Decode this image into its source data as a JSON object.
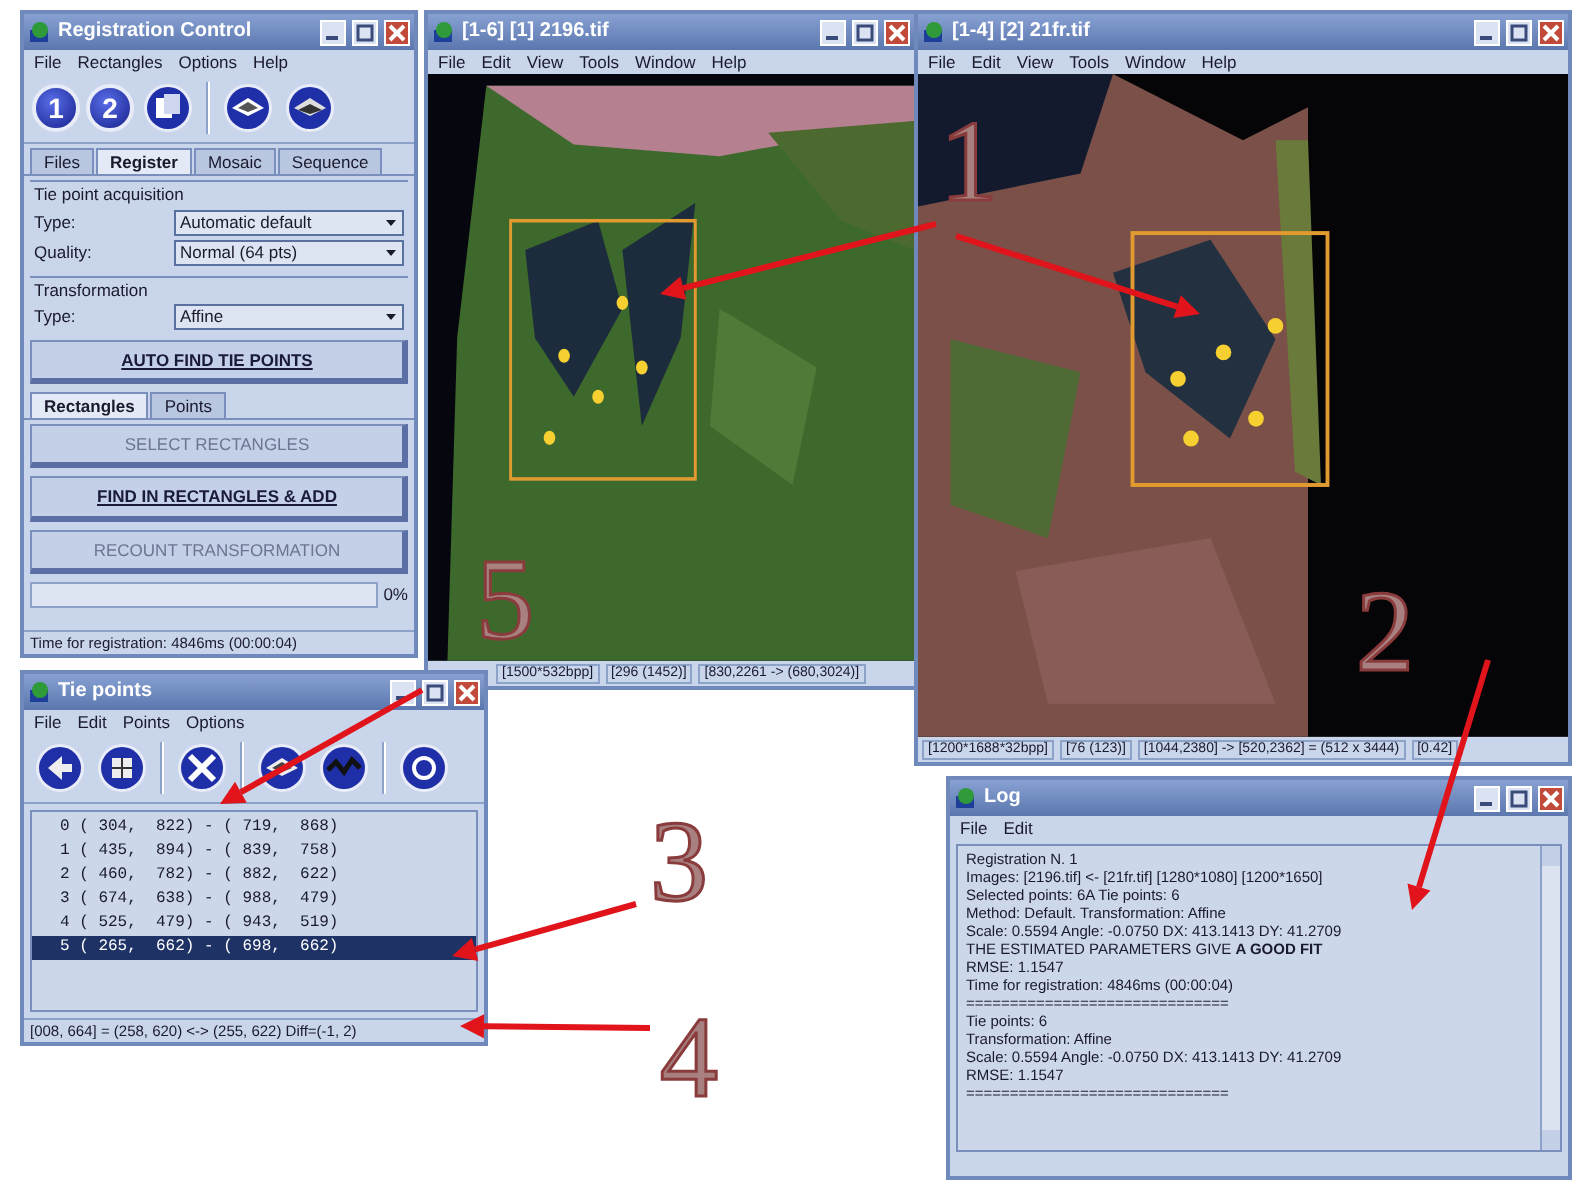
{
  "registration_control": {
    "title": "Registration Control",
    "menu": [
      "File",
      "Rectangles",
      "Options",
      "Help"
    ],
    "toolbar": [
      {
        "kind": "number",
        "label": "1"
      },
      {
        "kind": "number",
        "label": "2"
      },
      {
        "kind": "icon"
      },
      {
        "kind": "separator"
      },
      {
        "kind": "icon"
      },
      {
        "kind": "icon"
      }
    ],
    "tabs": [
      {
        "label": "Files",
        "selected": false
      },
      {
        "label": "Register",
        "selected": true
      },
      {
        "label": "Mosaic",
        "selected": false
      },
      {
        "label": "Sequence",
        "selected": false
      }
    ],
    "acquisition": {
      "legend": "Tie point acquisition",
      "fields": [
        {
          "label": "Type:",
          "value": "Automatic default"
        },
        {
          "label": "Quality:",
          "value": "Normal (64 pts)"
        }
      ]
    },
    "transformation": {
      "legend": "Transformation",
      "fields": [
        {
          "label": "Type:",
          "value": "Affine"
        }
      ]
    },
    "auto_button": {
      "label": "AUTO FIND TIE POINTS",
      "disabled": false
    },
    "subtabs": [
      {
        "label": "Rectangles",
        "selected": true
      },
      {
        "label": "Points",
        "selected": false
      }
    ],
    "rect_buttons": [
      {
        "label": "SELECT RECTANGLES",
        "disabled": true
      },
      {
        "label": "FIND IN RECTANGLES & ADD",
        "disabled": false
      }
    ],
    "recount_button": {
      "label": "RECOUNT TRANSFORMATION",
      "disabled": true
    },
    "progress": {
      "level": 0,
      "reading": "0%"
    },
    "status": "Time for registration: 4846ms (00:00:04)"
  },
  "image_windows": [
    {
      "title": "[1-6] [1] 2196.tif",
      "menu": [
        "File",
        "Edit",
        "View",
        "Tools",
        "Window",
        "Help"
      ],
      "status": [
        "[1500*532bpp]",
        "[296 (1452)]",
        "[830,2261 -> (680,3024)]"
      ]
    },
    {
      "title": "[1-4] [2] 21fr.tif",
      "menu": [
        "File",
        "Edit",
        "View",
        "Tools",
        "Window",
        "Help"
      ],
      "status": [
        "[1200*1688*32bpp]",
        "[76 (123)]",
        "[1044,2380] -> [520,2362] = (512 x 3444)",
        "[0.42]"
      ]
    }
  ],
  "tie_points": {
    "title": "Tie points",
    "menu": [
      "File",
      "Edit",
      "Points",
      "Options"
    ],
    "toolbar": [
      {
        "kind": "icon"
      },
      {
        "kind": "icon"
      },
      {
        "kind": "separator"
      },
      {
        "kind": "icon"
      },
      {
        "kind": "separator"
      },
      {
        "kind": "icon"
      },
      {
        "kind": "icon"
      },
      {
        "kind": "separator"
      },
      {
        "kind": "icon"
      }
    ],
    "rows": [
      {
        "text": "0 ( 304,  822) - ( 719,  868)",
        "selected": false
      },
      {
        "text": "1 ( 435,  894) - ( 839,  758)",
        "selected": false
      },
      {
        "text": "2 ( 460,  782) - ( 882,  622)",
        "selected": false
      },
      {
        "text": "3 ( 674,  638) - ( 988,  479)",
        "selected": false
      },
      {
        "text": "4 ( 525,  479) - ( 943,  519)",
        "selected": false
      },
      {
        "text": "5 ( 265,  662) - ( 698,  662)",
        "selected": true
      }
    ],
    "status": "[008, 664] = (258, 620) <-> (255, 622) Diff=(-1, 2)"
  },
  "log": {
    "title": "Log",
    "menu": [
      "File",
      "Edit"
    ],
    "lines": [
      "Registration N. 1",
      "Images: [2196.tif] <- [21fr.tif] [1280*1080] [1200*1650]",
      "Selected points: 6A Tie points: 6",
      "Method: Default. Transformation: Affine",
      "Scale: 0.5594 Angle: -0.0750 DX: 413.1413 DY: 41.2709",
      "THE ESTIMATED PARAMETERS GIVE **A GOOD FIT**",
      "RMSE: 1.1547",
      "Time for registration: 4846ms (00:00:04)",
      "==============================",
      "Tie points: 6",
      "Transformation: Affine",
      "Scale: 0.5594 Angle: -0.0750 DX: 413.1413 DY: 41.2709",
      "RMSE: 1.1547",
      "=============================="
    ]
  },
  "annotations": [
    {
      "label": "1"
    },
    {
      "label": "2"
    },
    {
      "label": "3"
    },
    {
      "label": "4"
    },
    {
      "label": "5"
    }
  ]
}
